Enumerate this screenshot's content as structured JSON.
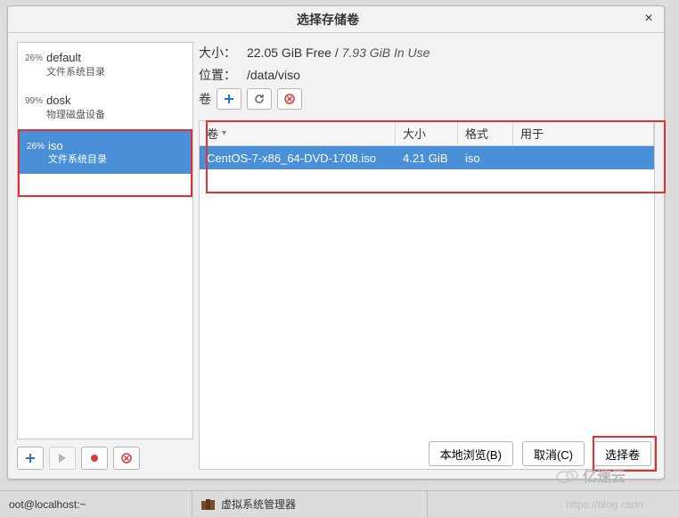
{
  "dialog": {
    "title": "选择存储卷",
    "close_glyph": "×"
  },
  "pools": [
    {
      "pct": "26%",
      "name": "default",
      "sub": "文件系统目录"
    },
    {
      "pct": "99%",
      "name": "dosk",
      "sub": "物理磁盘设备"
    },
    {
      "pct": "26%",
      "name": "iso",
      "sub": "文件系统目录"
    }
  ],
  "info": {
    "size_label": "大小：",
    "free": "22.05 GiB Free",
    "sep": " / ",
    "inuse": "7.93 GiB In Use",
    "loc_label": "位置：",
    "loc_value": "/data/viso",
    "vol_label": "卷"
  },
  "columns": {
    "vol": "卷",
    "size": "大小",
    "format": "格式",
    "usedby": "用于"
  },
  "row": {
    "name": "CentOS-7-x86_64-DVD-1708.iso",
    "size": "4.21 GiB",
    "format": "iso",
    "usedby": ""
  },
  "buttons": {
    "browse": "本地浏览(B)",
    "cancel": "取消(C)",
    "select": "选择卷"
  },
  "taskbar": {
    "term": "oot@localhost:~",
    "vmm": "虚拟系统管理器"
  },
  "blog": "https://blog.csdn",
  "watermark": "亿速云",
  "colors": {
    "accent": "#4a90d9",
    "highlight": "#e03030"
  }
}
